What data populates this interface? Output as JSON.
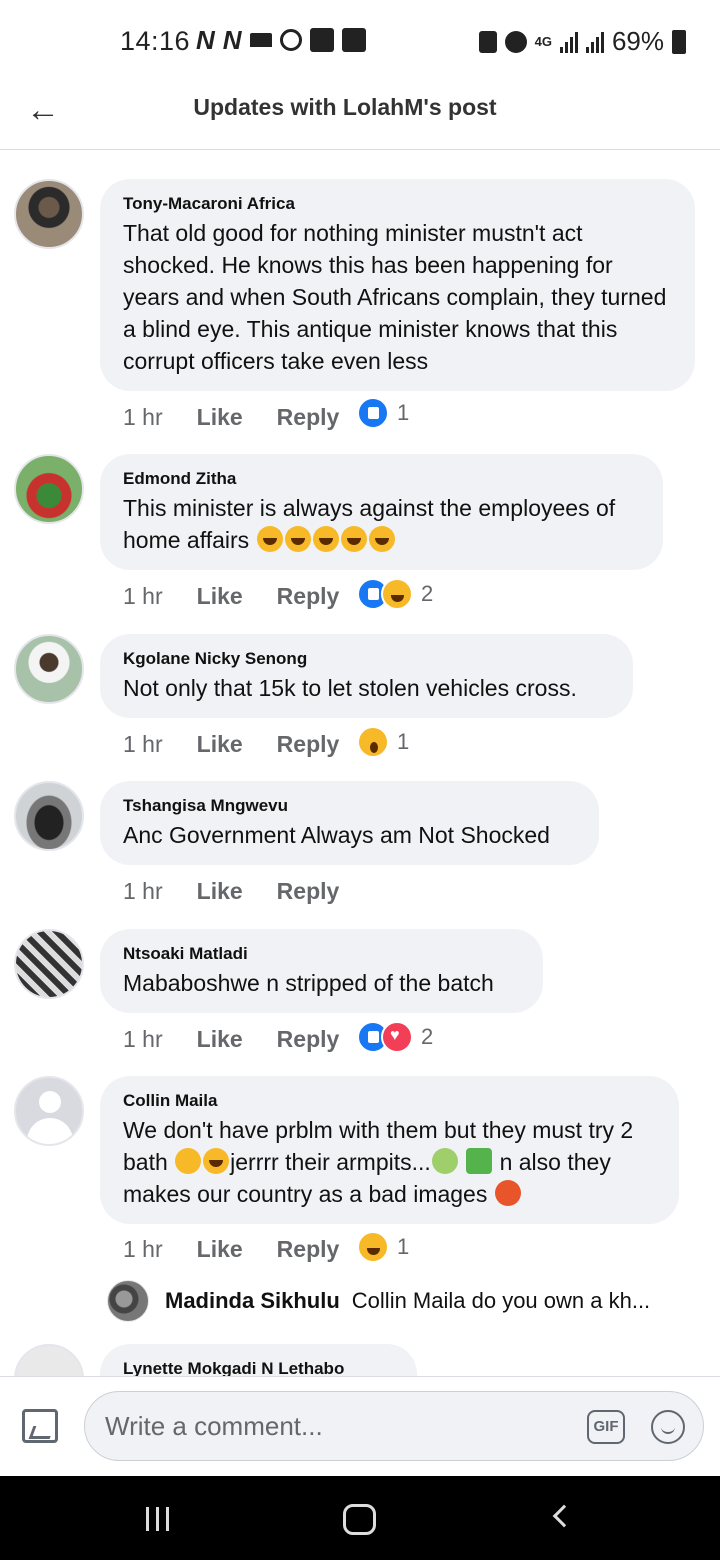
{
  "status_bar": {
    "time": "14:16",
    "network": "4G",
    "battery": "69%"
  },
  "header": {
    "title": "Updates with LolahM's post"
  },
  "comments": [
    {
      "author": "Tony-Macaroni Africa",
      "text": "That old good for nothing minister mustn't act shocked. He knows this has been happening for years and when South Africans complain, they turned a blind eye. This antique minister knows that this corrupt officers take even less",
      "time": "1 hr",
      "like_label": "Like",
      "reply_label": "Reply",
      "reactions": [
        "like"
      ],
      "reaction_count": "1"
    },
    {
      "author": "Edmond Zitha",
      "text": "This minister is always against the employees of home affairs",
      "emojis": [
        "laughing-emoji",
        "laughing-emoji",
        "laughing-emoji",
        "laughing-emoji",
        "laughing-emoji"
      ],
      "time": "1 hr",
      "like_label": "Like",
      "reply_label": "Reply",
      "reactions": [
        "like",
        "haha"
      ],
      "reaction_count": "2"
    },
    {
      "author": "Kgolane Nicky Senong",
      "text": "Not only that 15k to let stolen vehicles cross.",
      "time": "1 hr",
      "like_label": "Like",
      "reply_label": "Reply",
      "reactions": [
        "wow"
      ],
      "reaction_count": "1"
    },
    {
      "author": "Tshangisa Mngwevu",
      "text": "Anc Government Always am Not Shocked",
      "time": "1 hr",
      "like_label": "Like",
      "reply_label": "Reply",
      "reactions": [],
      "reaction_count": ""
    },
    {
      "author": "Ntsoaki Matladi",
      "text": "Mababoshwe n stripped of the batch",
      "time": "1 hr",
      "like_label": "Like",
      "reply_label": "Reply",
      "reactions": [
        "like",
        "love"
      ],
      "reaction_count": "2"
    },
    {
      "author": "Collin Maila",
      "text_parts": [
        "We don't have prblm with them but they must try 2 bath ",
        "jerrrr their armpits...",
        " n also they makes our country as a bad images "
      ],
      "time": "1 hr",
      "like_label": "Like",
      "reply_label": "Reply",
      "reactions": [
        "haha"
      ],
      "reaction_count": "1"
    }
  ],
  "reply_preview": {
    "name": "Madinda Sikhulu",
    "text": "Collin Maila do you own a kh..."
  },
  "partial_comment": {
    "author": "Lynette Mokgadi N Lethabo"
  },
  "composer": {
    "placeholder": "Write a comment...",
    "gif_label": "GIF"
  },
  "colors": {
    "accent": "#1877f2",
    "bubble": "#f0f2f5",
    "meta_text": "#65676b"
  }
}
